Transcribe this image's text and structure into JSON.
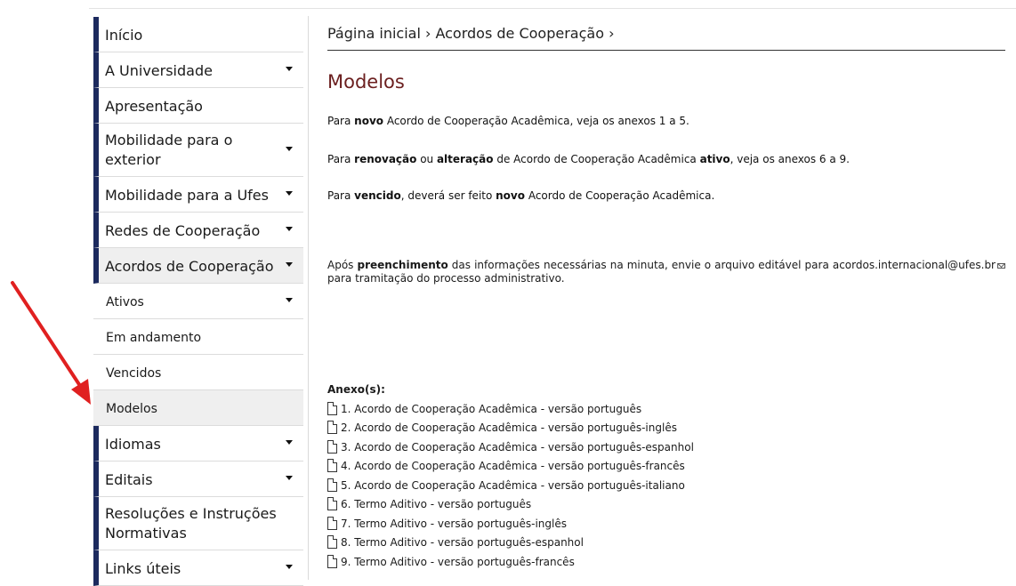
{
  "sidebar": {
    "items": [
      {
        "label": "Início",
        "caret": false
      },
      {
        "label": "A Universidade",
        "caret": true
      },
      {
        "label": "Apresentação",
        "caret": false
      },
      {
        "label": "Mobilidade para o exterior",
        "caret": true
      },
      {
        "label": "Mobilidade para a Ufes",
        "caret": true
      },
      {
        "label": "Redes de Cooperação",
        "caret": true
      },
      {
        "label": "Acordos de Cooperação",
        "caret": true
      }
    ],
    "subitems": [
      {
        "label": "Ativos",
        "caret": true
      },
      {
        "label": "Em andamento",
        "caret": false
      },
      {
        "label": "Vencidos",
        "caret": false
      },
      {
        "label": "Modelos",
        "caret": false
      }
    ],
    "items_after": [
      {
        "label": "Idiomas",
        "caret": true
      },
      {
        "label": "Editais",
        "caret": true
      },
      {
        "label": "Resoluções e Instruções Normativas",
        "caret": false
      },
      {
        "label": "Links úteis",
        "caret": true
      }
    ]
  },
  "breadcrumb": "Página inicial › Acordos de Cooperação ›",
  "title": "Modelos",
  "paragraphs": {
    "p1": {
      "a": "Para ",
      "b1": "novo",
      "c": " Acordo de Cooperação Acadêmica, veja os anexos 1 a 5."
    },
    "p2": {
      "a": "Para ",
      "b1": "renovação",
      "c": " ou ",
      "b2": "alteração",
      "d": " de Acordo de Cooperação Acadêmica ",
      "b3": "ativo",
      "e": ", veja os anexos 6 a 9."
    },
    "p3": {
      "a": "Para ",
      "b1": "vencido",
      "c": ", deverá ser feito ",
      "b2": "novo",
      "d": " Acordo de Cooperação Acadêmica."
    },
    "p4": {
      "a": "Após ",
      "b1": "preenchimento",
      "c": " das informações necessárias na minuta, envie o arquivo editável para ",
      "email": "acordos.internacional@ufes.br",
      "d": " para tramitação do processo administrativo."
    }
  },
  "annex_title": "Anexo(s):",
  "annexes": [
    "1. Acordo de Cooperação Acadêmica - versão português",
    "2. Acordo de Cooperação Acadêmica - versão português-inglês",
    "3. Acordo de Cooperação Acadêmica - versão português-espanhol",
    "4. Acordo de Cooperação Acadêmica - versão português-francês",
    "5. Acordo de Cooperação Acadêmica - versão português-italiano",
    "6. Termo Aditivo - versão português",
    "7. Termo Aditivo - versão português-inglês",
    "8. Termo Aditivo - versão português-espanhol",
    "9. Termo Aditivo - versão português-francês"
  ],
  "colors": {
    "nav_bar": "#1c2a5e",
    "title": "#6b1f1f",
    "arrow": "#e02020",
    "active_bg": "#efefef"
  }
}
